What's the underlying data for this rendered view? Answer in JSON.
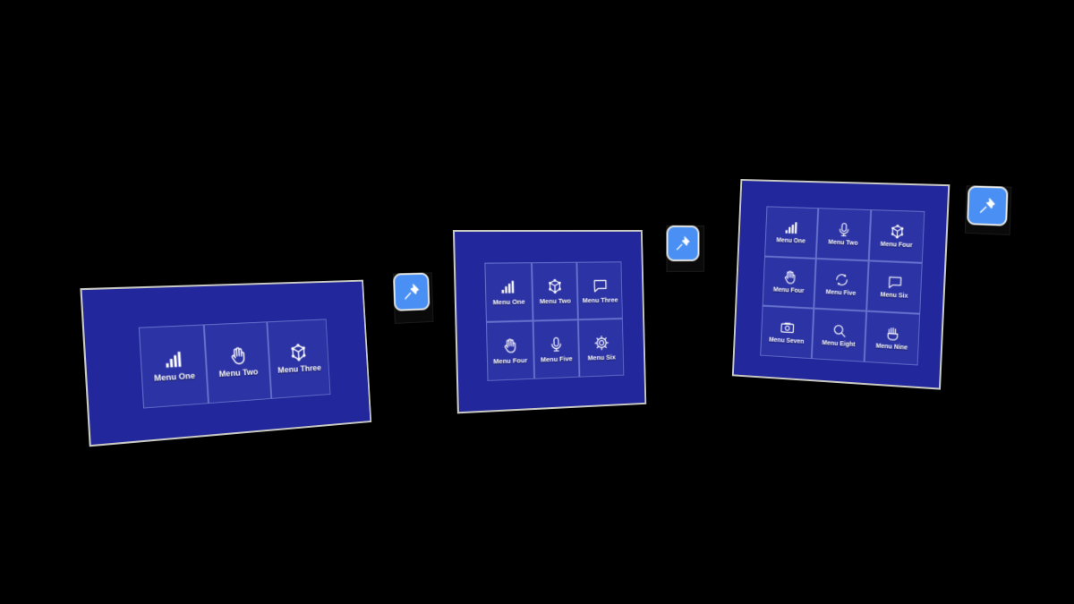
{
  "scene": {
    "background_color": "#000000",
    "panel_fill_color": "#22279b",
    "panel_border_color": "#c9c9c4",
    "tile_border_color": "#aabeff",
    "pin_button_color": "#4a90f4",
    "icon_color": "#ffffff"
  },
  "panels": [
    {
      "id": "panel-one",
      "name": "three-item-menu-panel",
      "layout": "1x3",
      "columns": 3,
      "rows": 1,
      "items": [
        {
          "label": "Menu One",
          "icon": "bar-chart-icon"
        },
        {
          "label": "Menu Two",
          "icon": "hand-icon"
        },
        {
          "label": "Menu Three",
          "icon": "cube-nodes-icon"
        }
      ],
      "pin": {
        "name": "pin-button",
        "icon": "pushpin-icon",
        "label": "Pin"
      }
    },
    {
      "id": "panel-two",
      "name": "six-item-menu-panel",
      "layout": "2x3",
      "columns": 3,
      "rows": 2,
      "items": [
        {
          "label": "Menu One",
          "icon": "bar-chart-icon"
        },
        {
          "label": "Menu Two",
          "icon": "cube-nodes-icon"
        },
        {
          "label": "Menu Three",
          "icon": "speech-bubble-icon"
        },
        {
          "label": "Menu Four",
          "icon": "hand-icon"
        },
        {
          "label": "Menu Five",
          "icon": "microphone-icon"
        },
        {
          "label": "Menu Six",
          "icon": "gear-icon"
        }
      ],
      "pin": {
        "name": "pin-button",
        "icon": "pushpin-icon",
        "label": "Pin"
      }
    },
    {
      "id": "panel-three",
      "name": "nine-item-menu-panel",
      "layout": "3x3",
      "columns": 3,
      "rows": 3,
      "items": [
        {
          "label": "Menu One",
          "icon": "bar-chart-icon"
        },
        {
          "label": "Menu Two",
          "icon": "microphone-icon"
        },
        {
          "label": "Menu Four",
          "icon": "cube-nodes-icon"
        },
        {
          "label": "Menu Four",
          "icon": "hand-icon"
        },
        {
          "label": "Menu Five",
          "icon": "refresh-icon"
        },
        {
          "label": "Menu Six",
          "icon": "speech-bubble-icon"
        },
        {
          "label": "Menu Seven",
          "icon": "camera-icon"
        },
        {
          "label": "Menu Eight",
          "icon": "search-icon"
        },
        {
          "label": "Menu Nine",
          "icon": "hand-fingers-icon"
        }
      ],
      "pin": {
        "name": "pin-button",
        "icon": "pushpin-icon",
        "label": "Pin"
      }
    }
  ]
}
